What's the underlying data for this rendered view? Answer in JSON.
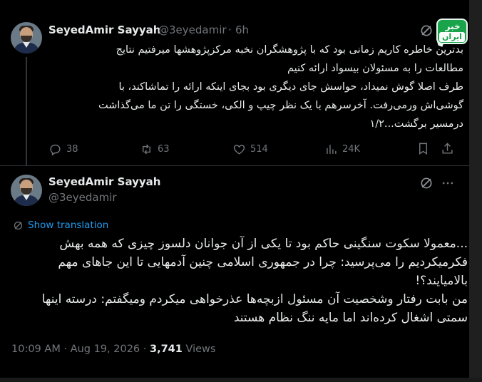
{
  "tweet1": {
    "author_name": "SeyedAmir Sayyah",
    "author_handle": "@3eyedamir",
    "separator": "·",
    "time_ago": "6h",
    "lines": [
      "بدترین خاطره کاریم زمانی بود که با پژوهشگران نخبه مرکزپژوهشها میرفتیم نتایج",
      "مطالعات را به مسئولان بیسواد ارائه کنیم",
      "طرف اصلا گوش نمیداد، حواسش جای دیگری بود بجای اینکه ارائه را تماشاکند، با",
      "گوشی‌اش ورمی‌رفت. آخرسرهم با یک نظر چیپ و الکی، خستگی را تن ما می‌گذاشت",
      "درمسیر برگشت...۱/۲"
    ],
    "actions": {
      "replies": "38",
      "reposts": "63",
      "likes": "514",
      "views": "24K"
    }
  },
  "tweet2": {
    "author_name": "SeyedAmir Sayyah",
    "author_handle": "@3eyedamir",
    "show_translation": "Show translation",
    "lines": [
      "...معمولا سکوت سنگینی حاکم بود تا یکی از آن جوانان دلسوز چیزی که همه بهش",
      "فکرمیکردیم را می‌پرسید: چرا در جمهوری اسلامی چنین آدمهایی تا این جاهای مهم",
      "بالامیایند؟!",
      "من بابت رفتار وشخصیت آن مسئول ازبچه‌ها عذرخواهی میکردم ومیگفتم: درسته اینها",
      "سمتی اشغال کرده‌اند اما مایه ننگ نظام هستند"
    ],
    "meta": {
      "time": "10:09 AM",
      "date": "Aug 19, 2026",
      "views_count": "3,741",
      "views_label": "Views",
      "separator": "·"
    }
  },
  "badge": {
    "line1": "خبر",
    "line2": "ایران",
    "color": "#19a44b"
  },
  "colors": {
    "background": "#000000",
    "text": "#e7e9ea",
    "muted": "#71767b",
    "link": "#1d9bf0",
    "divider": "#2f3336"
  },
  "icons": {
    "grok": "grok-icon",
    "more": "more-icon",
    "reply": "reply-icon",
    "repost": "repost-icon",
    "like": "heart-icon",
    "views": "views-icon",
    "bookmark": "bookmark-icon",
    "share": "share-icon",
    "translate": "translate-icon"
  }
}
